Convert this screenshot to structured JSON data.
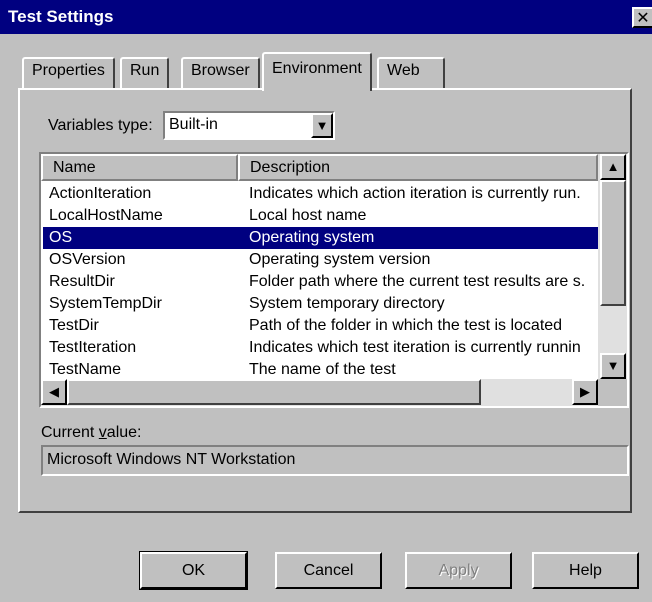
{
  "window": {
    "title": "Test Settings",
    "close_glyph": "✕"
  },
  "tabs": [
    {
      "label": "Properties",
      "active": false
    },
    {
      "label": "Run",
      "active": false
    },
    {
      "label": "Browser",
      "active": false
    },
    {
      "label": "Environment",
      "active": true
    },
    {
      "label": "Web",
      "active": false
    }
  ],
  "variables_type": {
    "label": "Variables type:",
    "value": "Built-in"
  },
  "list": {
    "columns": [
      "Name",
      "Description"
    ],
    "rows": [
      {
        "name": "ActionIteration",
        "description": "Indicates which action iteration is currently run."
      },
      {
        "name": "LocalHostName",
        "description": "Local host name"
      },
      {
        "name": "OS",
        "description": "Operating system",
        "selected": true
      },
      {
        "name": "OSVersion",
        "description": "Operating system version"
      },
      {
        "name": "ResultDir",
        "description": "Folder path where the current test results are s."
      },
      {
        "name": "SystemTempDir",
        "description": "System temporary directory"
      },
      {
        "name": "TestDir",
        "description": "Path of the folder in which the test is located"
      },
      {
        "name": "TestIteration",
        "description": "Indicates which test iteration is currently runnin"
      },
      {
        "name": "TestName",
        "description": "The name of the test"
      }
    ]
  },
  "current_value": {
    "label_pre": "Current ",
    "label_accel": "v",
    "label_post": "alue:",
    "value": "Microsoft Windows NT Workstation"
  },
  "buttons": {
    "ok": "OK",
    "cancel": "Cancel",
    "apply": "Apply",
    "help": "Help"
  },
  "glyphs": {
    "up": "▲",
    "down": "▼",
    "left": "◀",
    "right": "▶"
  },
  "colors": {
    "title_bar": "#000080",
    "selection": "#000080",
    "face": "#c0c0c0"
  }
}
